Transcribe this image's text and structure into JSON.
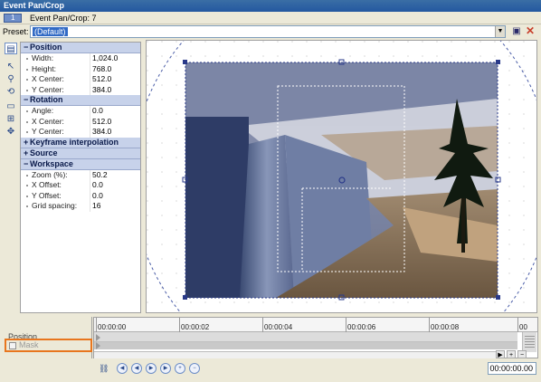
{
  "window": {
    "title": "Event Pan/Crop"
  },
  "header": {
    "tab_icon_label": "1",
    "caption": "Event Pan/Crop: 7"
  },
  "preset": {
    "label": "Preset:",
    "value": "(Default)"
  },
  "tools": [
    {
      "icon": "show-properties-icon"
    },
    {
      "icon": "normal-edit-tool-icon"
    },
    {
      "icon": "zoom-tool-icon"
    },
    {
      "icon": "enable-rotation-icon"
    },
    {
      "icon": "lock-aspect-ratio-icon"
    },
    {
      "icon": "size-about-center-icon"
    },
    {
      "icon": "move-freely-icon"
    }
  ],
  "properties": {
    "position": {
      "title": "Position",
      "rows": [
        {
          "key": "Width:",
          "value": "1,024.0"
        },
        {
          "key": "Height:",
          "value": "768.0"
        },
        {
          "key": "X Center:",
          "value": "512.0"
        },
        {
          "key": "Y Center:",
          "value": "384.0"
        }
      ]
    },
    "rotation": {
      "title": "Rotation",
      "rows": [
        {
          "key": "Angle:",
          "value": "0.0"
        },
        {
          "key": "X Center:",
          "value": "512.0"
        },
        {
          "key": "Y Center:",
          "value": "384.0"
        }
      ]
    },
    "keyframe": {
      "title": "Keyframe interpolation"
    },
    "source": {
      "title": "Source"
    },
    "workspace": {
      "title": "Workspace",
      "rows": [
        {
          "key": "Zoom (%):",
          "value": "50.2"
        },
        {
          "key": "X Offset:",
          "value": "0.0"
        },
        {
          "key": "Y Offset:",
          "value": "0.0"
        },
        {
          "key": "Grid spacing:",
          "value": "16"
        }
      ]
    }
  },
  "timeline": {
    "position_label": "Position",
    "mask_label": "Mask",
    "ruler": [
      "00:00:00",
      "00:00:02",
      "00:00:04",
      "00:00:06",
      "00:00:08",
      "00"
    ],
    "current_time": "00:00:00.00"
  },
  "colors": {
    "accent_highlight": "#e8761e",
    "selection": "#316ac5",
    "section_header": "#c7d2ea"
  }
}
